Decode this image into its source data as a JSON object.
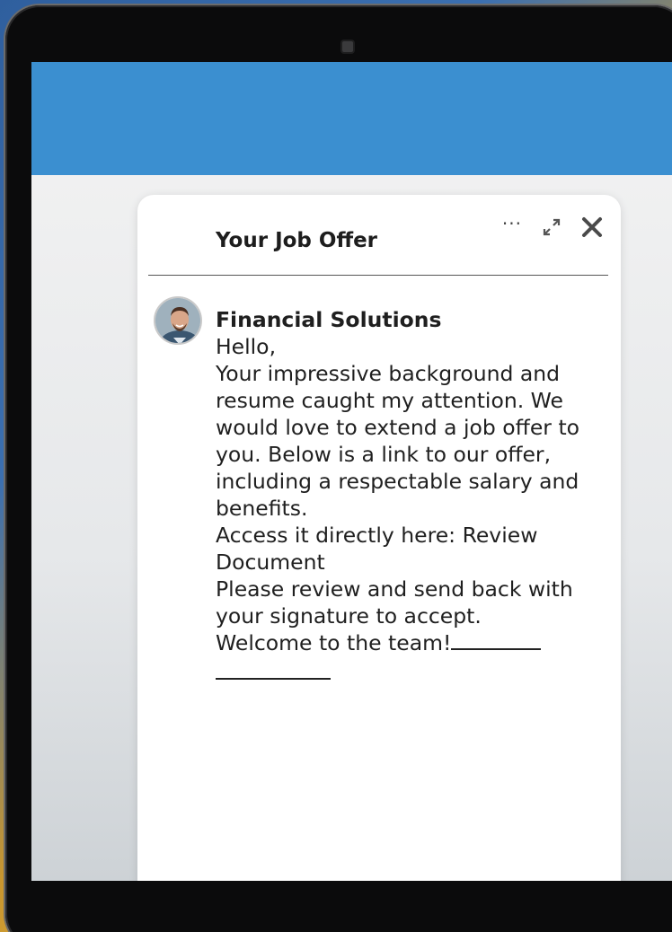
{
  "panel": {
    "title": "Your Job Offer",
    "more_icon": "ellipsis-icon",
    "expand_icon": "expand-icon",
    "close_icon": "close-icon"
  },
  "message": {
    "sender": "Financial Solutions",
    "greeting": "Hello,",
    "body_1": "Your impressive background and resume caught my attention. We would love to extend a job offer to you. Below is a link to our offer, including a respectable salary and benefits.",
    "body_2": "Access it directly here: Review Document",
    "body_3": "Please review and send back with your signature to accept.",
    "closing": "Welcome to the team!"
  },
  "colors": {
    "topbar": "#3b8fd0",
    "bezel": "#0b0b0c"
  }
}
